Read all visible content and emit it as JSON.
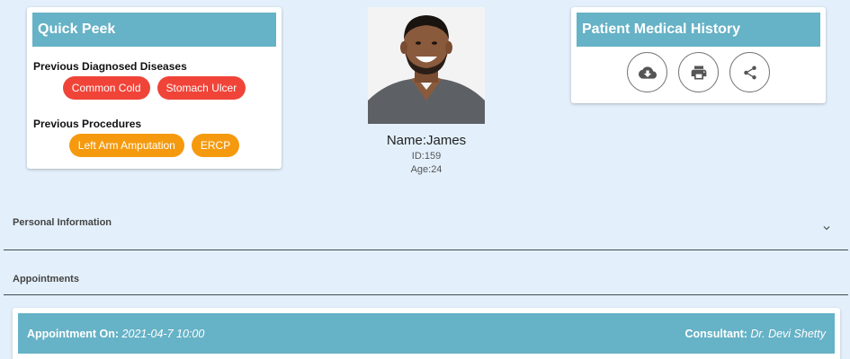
{
  "quick_peek": {
    "title": "Quick Peek",
    "diseases_title": "Previous Diagnosed Diseases",
    "diseases": [
      "Common Cold",
      "Stomach Ulcer"
    ],
    "procedures_title": "Previous Procedures",
    "procedures": [
      "Left Arm Amputation",
      "ERCP"
    ]
  },
  "profile": {
    "name": "Name:James",
    "id": "ID:159",
    "age": "Age:24"
  },
  "history": {
    "title": "Patient Medical History",
    "buttons": [
      "cloud-download-icon",
      "print-icon",
      "share-icon"
    ]
  },
  "personal_info": {
    "label": "Personal Information"
  },
  "appointments": {
    "label": "Appointments"
  },
  "appointment": {
    "on_label": "Appointment On:",
    "on_value": "2021-04-7 10:00",
    "consultant_label": "Consultant:",
    "consultant_value": "Dr. Devi Shetty"
  },
  "colors": {
    "header": "#66b2c6",
    "disease_chip": "#f04438",
    "procedure_chip": "#f59a0e",
    "background": "#e3f0fb"
  }
}
